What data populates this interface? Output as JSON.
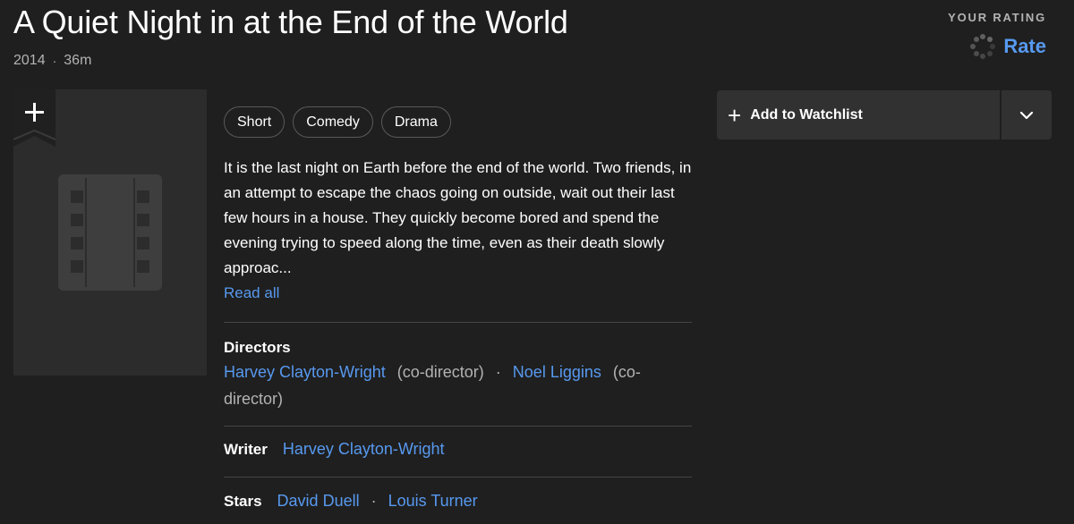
{
  "title": "A Quiet Night in at the End of the World",
  "meta": {
    "year": "2014",
    "separator": "·",
    "runtime": "36m"
  },
  "rating": {
    "label": "YOUR RATING",
    "button": "Rate"
  },
  "poster": {
    "add_icon": "plus-icon",
    "placeholder_icon": "film-strip-icon"
  },
  "genres": [
    "Short",
    "Comedy",
    "Drama"
  ],
  "plot": {
    "text": "It is the last night on Earth before the end of the world. Two friends, in an attempt to escape the chaos going on outside, wait out their last few hours in a house. They quickly become bored and spend the evening trying to speed along the time, even as their death slowly approac...",
    "read_all": "Read all"
  },
  "credits": {
    "directors": {
      "label": "Directors",
      "people": [
        {
          "name": "Harvey Clayton-Wright",
          "role": "(co-director)"
        },
        {
          "name": "Noel Liggins",
          "role": "(co-director)"
        }
      ],
      "separator": "·"
    },
    "writer": {
      "label": "Writer",
      "people": [
        "Harvey Clayton-Wright"
      ]
    },
    "stars": {
      "label": "Stars",
      "people": [
        "David Duell",
        "Louis Turner"
      ],
      "separator": "·"
    }
  },
  "watchlist": {
    "label": "Add to Watchlist",
    "plus": "+",
    "dropdown_icon": "chevron-down-icon"
  },
  "colors": {
    "background": "#1f1f1f",
    "link": "#5799ef",
    "poster": "#2c2c2c",
    "button": "#313131"
  }
}
